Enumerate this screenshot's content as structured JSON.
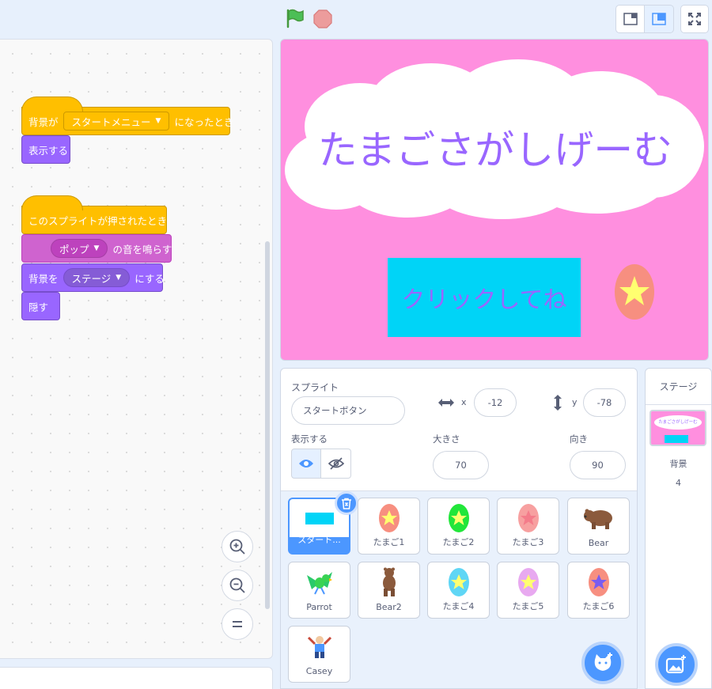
{
  "toolbar": {
    "green_flag_icon": "green-flag-icon",
    "stop_icon": "stop-icon",
    "colors": {
      "flag": "#4cbf56",
      "stop": "#ec9c9c"
    }
  },
  "code": {
    "script1": {
      "hat_prefix": "背景が",
      "hat_dropdown": "スタートメニュー",
      "hat_suffix": "になったとき",
      "block1": "表示する"
    },
    "script2": {
      "hat": "このスプライトが押されたとき",
      "sound_dropdown": "ポップ",
      "sound_suffix": "の音を鳴らす",
      "backdrop_prefix": "背景を",
      "backdrop_dropdown": "ステージ",
      "backdrop_suffix": "にする",
      "hide": "隠す"
    },
    "zoom": {
      "in": "zoom-in-icon",
      "out": "zoom-out-icon",
      "reset": "zoom-reset-icon"
    }
  },
  "stage": {
    "title": "たまごさがしげーむ",
    "start_button": "クリックしてね",
    "colors": {
      "background": "#ff8fdf",
      "title": "#9966ff",
      "button": "#00d4f7"
    }
  },
  "sprite_info": {
    "sprite_label": "スプライト",
    "sprite_name": "スタートボタン",
    "x_label": "x",
    "x_value": "-12",
    "y_label": "y",
    "y_value": "-78",
    "show_label": "表示する",
    "size_label": "大きさ",
    "size_value": "70",
    "direction_label": "向き",
    "direction_value": "90"
  },
  "sprites": [
    {
      "name": "スタート...",
      "selected": true
    },
    {
      "name": "たまご1"
    },
    {
      "name": "たまご2"
    },
    {
      "name": "たまご3"
    },
    {
      "name": "Bear"
    },
    {
      "name": "Parrot"
    },
    {
      "name": "Bear2"
    },
    {
      "name": "たまご4"
    },
    {
      "name": "たまご5"
    },
    {
      "name": "たまご6"
    },
    {
      "name": "Casey"
    }
  ],
  "stage_panel": {
    "title": "ステージ",
    "thumb_text": "たまごさがしげーむ",
    "backdrops_label": "背景",
    "backdrops_count": "4"
  }
}
